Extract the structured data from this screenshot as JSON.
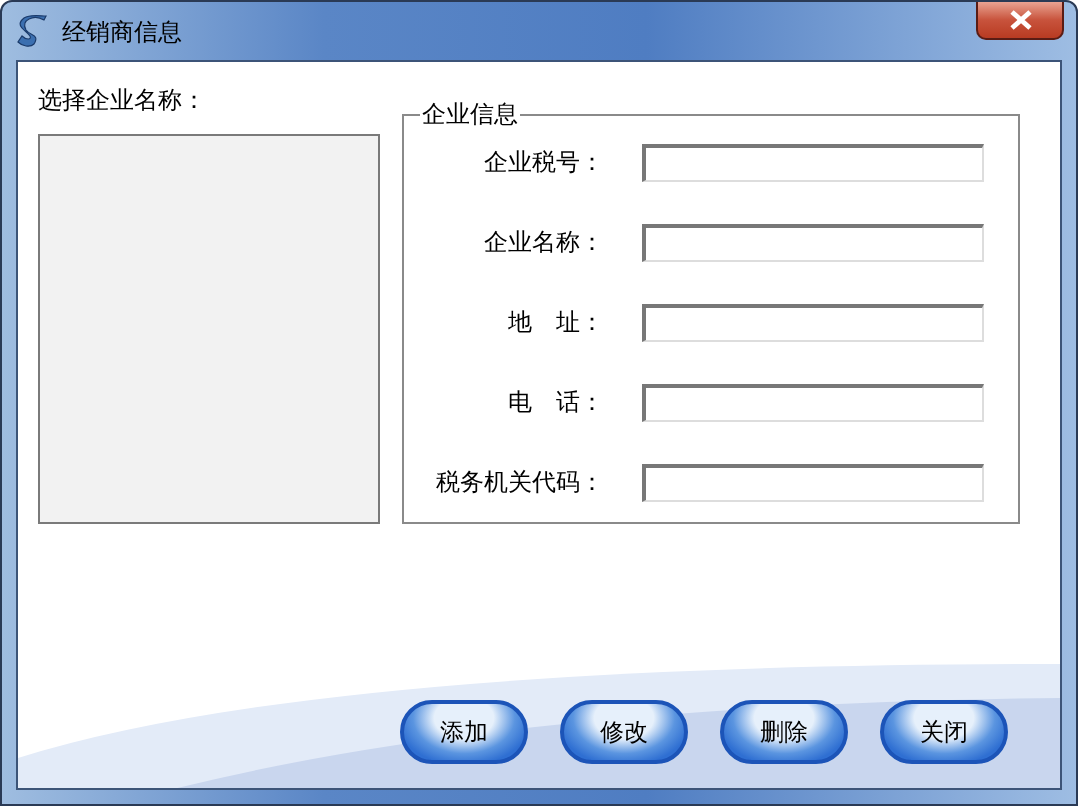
{
  "window": {
    "title": "经销商信息"
  },
  "list_label": "选择企业名称：",
  "info_group": {
    "title": "企业信息",
    "fields": [
      {
        "label": "企业税号："
      },
      {
        "label": "企业名称："
      },
      {
        "label": "地　址："
      },
      {
        "label": "电　话："
      },
      {
        "label": "税务机关代码："
      }
    ]
  },
  "buttons": [
    "添加",
    "修改",
    "删除",
    "关闭"
  ]
}
